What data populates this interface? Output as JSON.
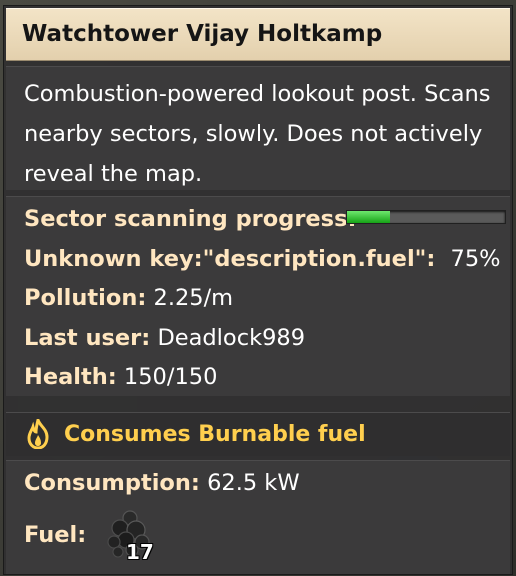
{
  "title": "Watchtower Vijay Holtkamp",
  "description": "Combustion-powered lookout post. Scans nearby sectors, slowly. Does not actively reveal the map.",
  "stats": {
    "scanning_label": "Sector scanning progress:",
    "scanning_progress": 0.27,
    "fuel_desc_label": "Unknown key:\"description.fuel\":",
    "fuel_desc_value": "75%",
    "pollution_label": "Pollution:",
    "pollution_value": "2.25/m",
    "last_user_label": "Last user:",
    "last_user_value": "Deadlock989",
    "health_label": "Health:",
    "health_value": "150/150"
  },
  "consumes": {
    "icon": "flame-icon",
    "label": "Consumes Burnable fuel"
  },
  "bottom": {
    "consumption_label": "Consumption:",
    "consumption_value": "62.5 kW",
    "fuel_label": "Fuel:",
    "fuel_icon": "coal-icon",
    "fuel_count": "17"
  },
  "colors": {
    "title_bg": "#f0e0c2",
    "label": "#ffe6c0",
    "consumes": "#ffcf4e",
    "progress": "#3ad23a"
  }
}
